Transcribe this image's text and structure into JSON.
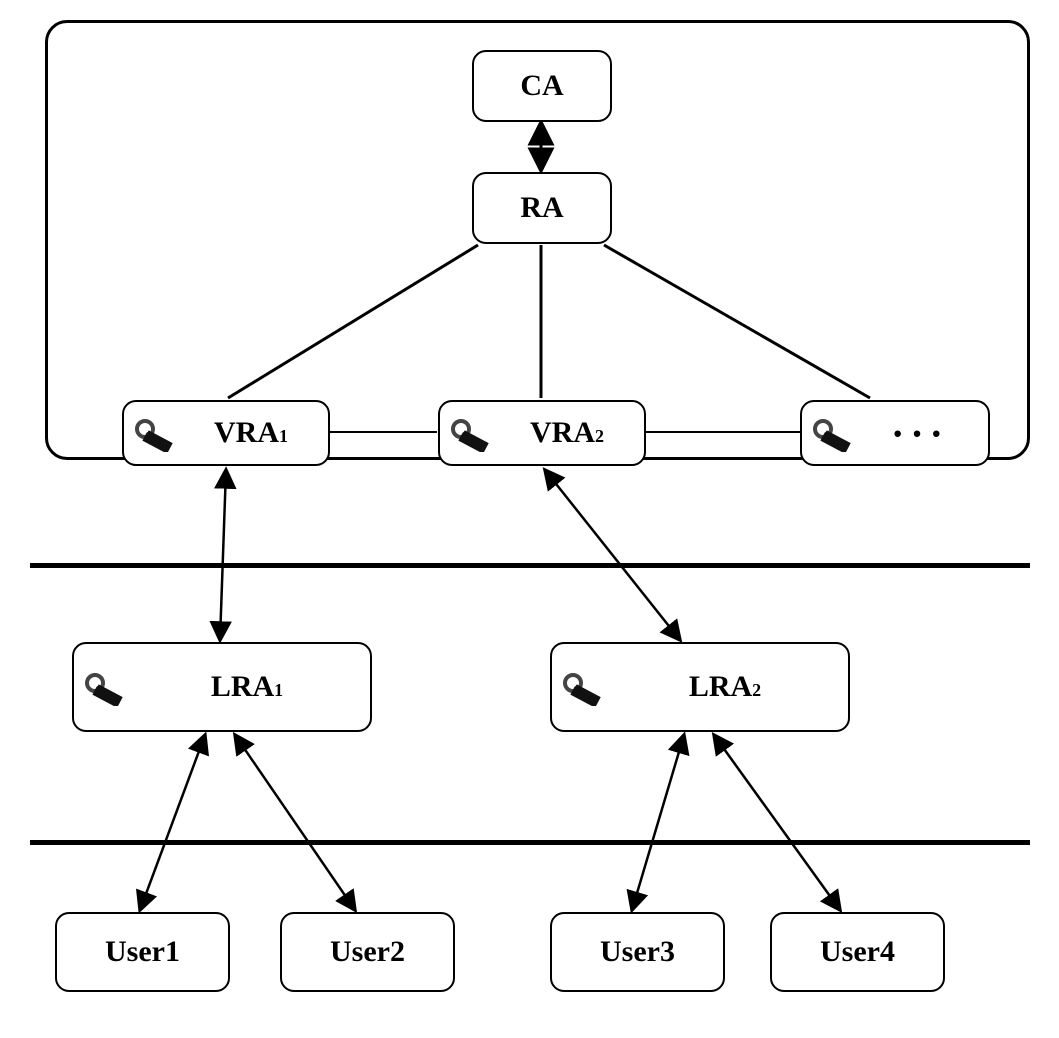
{
  "nodes": {
    "ca": {
      "label": "CA"
    },
    "ra": {
      "label": "RA"
    },
    "vra1": {
      "label": "VRA",
      "sub": "1"
    },
    "vra2": {
      "label": "VRA",
      "sub": "2"
    },
    "vra_more": {
      "label": "···"
    },
    "lra1": {
      "label": "LRA",
      "sub": "1"
    },
    "lra2": {
      "label": "LRA",
      "sub": "2"
    },
    "user1": {
      "label": "User1"
    },
    "user2": {
      "label": "User2"
    },
    "user3": {
      "label": "User3"
    },
    "user4": {
      "label": "User4"
    }
  }
}
